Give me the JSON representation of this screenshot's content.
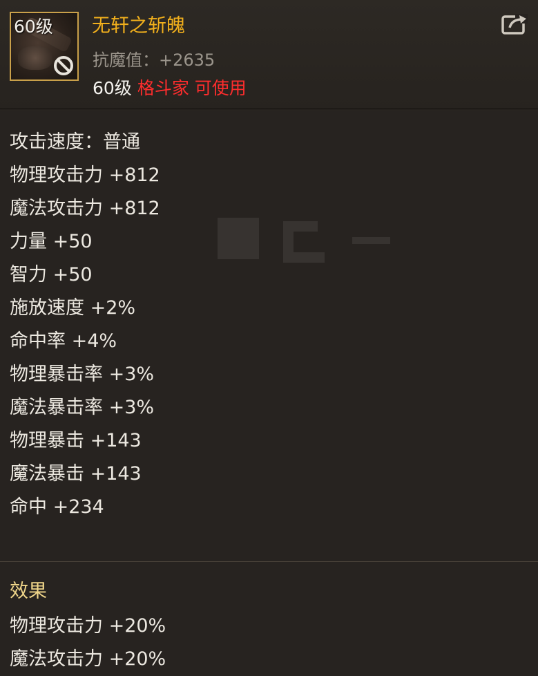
{
  "item": {
    "level_badge": "60级",
    "name": "无轩之斩魄",
    "resist": "抗魔值：+2635",
    "req_level": "60级",
    "req_class": "格斗家 可使用"
  },
  "stats": [
    "攻击速度：普通",
    "物理攻击力 +812",
    "魔法攻击力 +812",
    "力量 +50",
    "智力 +50",
    "施放速度 +2%",
    "命中率 +4%",
    "物理暴击率 +3%",
    "魔法暴击率 +3%",
    "物理暴击 +143",
    "魔法暴击 +143",
    "命中 +234"
  ],
  "effects": {
    "title": "效果",
    "items": [
      "物理攻击力 +20%",
      "魔法攻击力 +20%"
    ]
  },
  "icons": {
    "item_icon": "weapon-icon",
    "ban": "prohibited-icon",
    "share": "share-icon"
  },
  "colors": {
    "title": "#f2b01c",
    "class_requirement": "#ff2d2d",
    "effects_heading": "#f0d68a",
    "frame": "#c9a04a"
  }
}
